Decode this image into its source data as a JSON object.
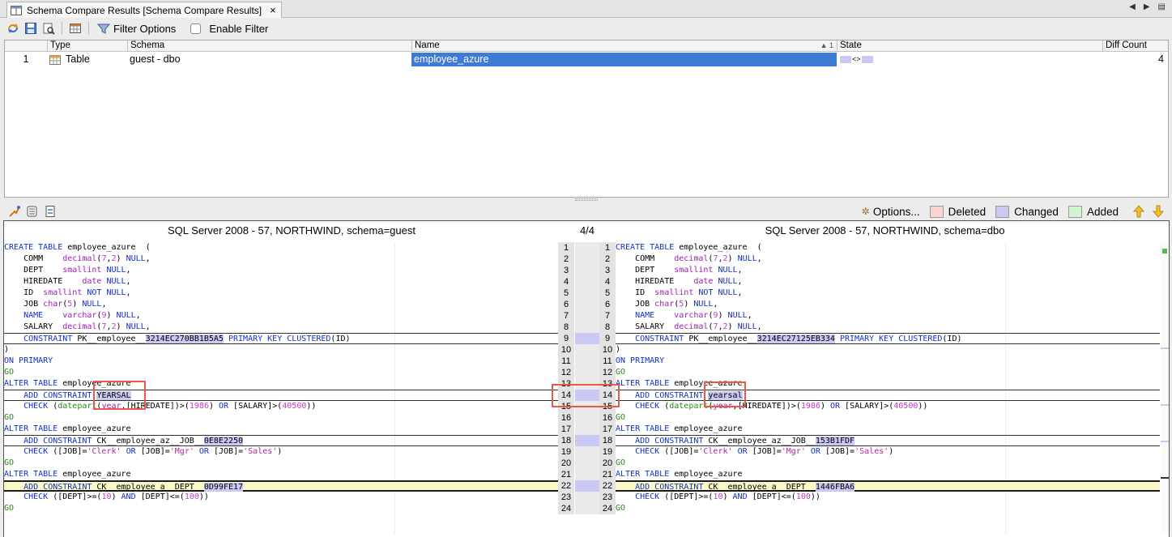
{
  "tab": {
    "title": "Schema Compare Results [Schema Compare Results]",
    "close": "×"
  },
  "toolbar": {
    "filter_options": "Filter Options",
    "enable_filter": "Enable Filter"
  },
  "table": {
    "columns": {
      "type": "Type",
      "schema": "Schema",
      "name": "Name",
      "sort": "▲ 1",
      "state": "State",
      "diff": "Diff Count"
    },
    "row": {
      "num": "1",
      "type": "Table",
      "schema": "guest - dbo",
      "name": "employee_azure",
      "state_arrow": "<>",
      "diff": "4"
    }
  },
  "legend": {
    "options": "Options...",
    "deleted": "Deleted",
    "changed": "Changed",
    "added": "Added",
    "colors": {
      "deleted": "#fad3d3",
      "changed": "#c9c9f3",
      "added": "#d3f3d3"
    }
  },
  "diff": {
    "left_title": "SQL Server 2008 - 57, NORTHWIND,  schema=guest",
    "right_title": "SQL Server 2008 - 57, NORTHWIND,  schema=dbo",
    "counter": "4/4",
    "left": {
      "pk_hash": "3214EC270BB1B5A5",
      "constraint": "YEARSAL",
      "job_hash": "0E8E2250",
      "dept_hash": "0D99FE17"
    },
    "right": {
      "pk_hash": "3214EC27125EB334",
      "constraint": "yearsal",
      "job_hash": "153B1FDF",
      "dept_hash": "1446FBA6"
    }
  }
}
